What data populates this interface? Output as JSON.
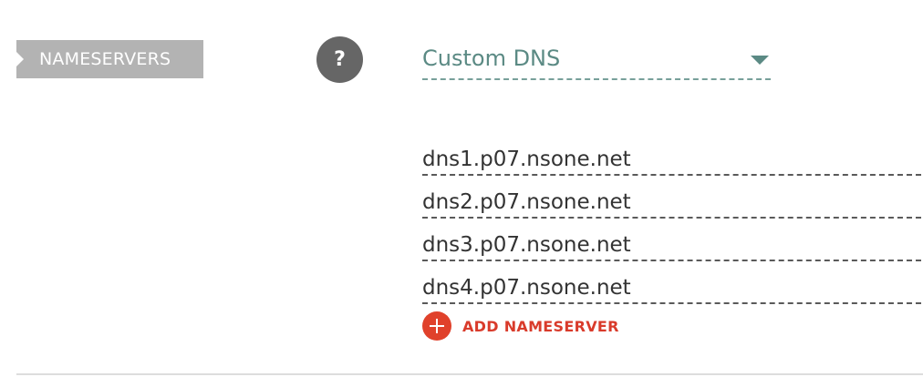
{
  "section": {
    "label": "NAMESERVERS",
    "help_glyph": "?"
  },
  "dns_select": {
    "value": "Custom DNS",
    "caret_icon": "caret-down-icon"
  },
  "nameservers": [
    "dns1.p07.nsone.net",
    "dns2.p07.nsone.net",
    "dns3.p07.nsone.net",
    "dns4.p07.nsone.net"
  ],
  "add_nameserver": {
    "label": "ADD NAMESERVER",
    "icon": "plus-circle-icon"
  },
  "colors": {
    "label_bg": "#b3b3b3",
    "help_bg": "#666666",
    "select_text": "#5b8a84",
    "accent_red": "#e0412b"
  }
}
